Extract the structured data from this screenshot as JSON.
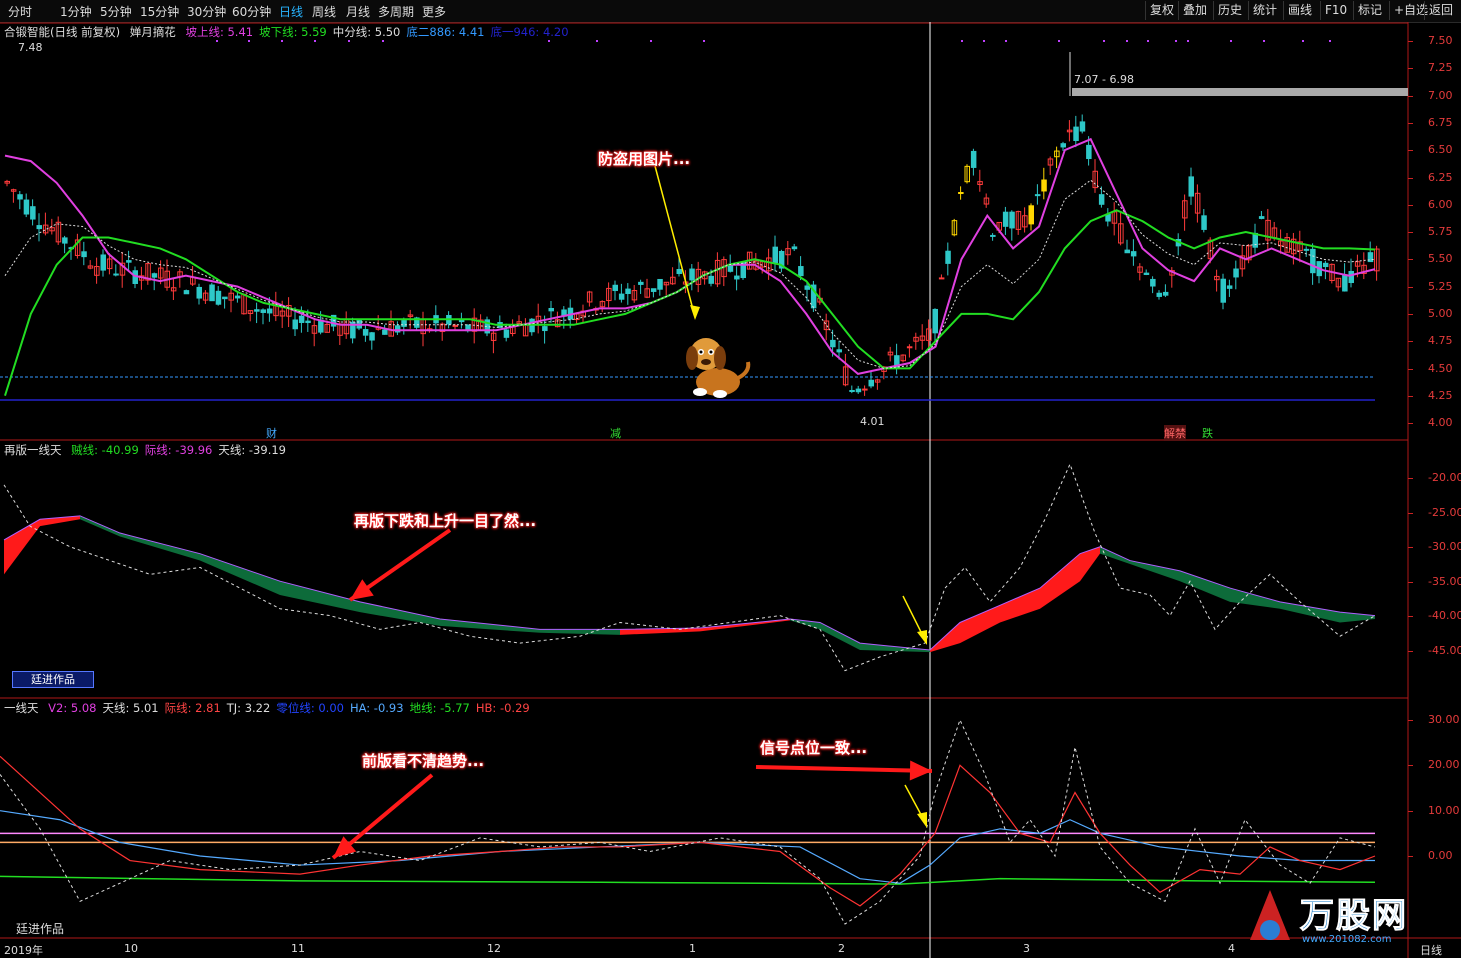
{
  "toolbar": {
    "periods": [
      "分时",
      "1分钟",
      "5分钟",
      "15分钟",
      "30分钟",
      "60分钟",
      "日线",
      "周线",
      "月线",
      "多周期",
      "更多"
    ],
    "active_period": "日线",
    "right_buttons": [
      "复权",
      "叠加",
      "历史",
      "统计",
      "画线",
      "F10",
      "标记",
      "+自选",
      "返回"
    ]
  },
  "panel1": {
    "stock": "合锻智能(日线 前复权)",
    "indicator": "婵月摘花",
    "legend": [
      {
        "label": "坡上线: 5.41",
        "color": "#e040e0"
      },
      {
        "label": "坡下线: 5.59",
        "color": "#22dd22"
      },
      {
        "label": "中分线: 5.50",
        "color": "#dddddd"
      },
      {
        "label": "底二886: 4.41",
        "color": "#3399ff"
      },
      {
        "label": "底一946: 4.20",
        "color": "#2222cc"
      }
    ],
    "axis_ticks": [
      "7.50",
      "7.25",
      "7.00",
      "6.75",
      "6.50",
      "6.25",
      "6.00",
      "5.75",
      "5.50",
      "5.25",
      "5.00",
      "4.75",
      "4.50",
      "4.25",
      "4.00"
    ],
    "high_label": "7.48",
    "low_label": "4.01",
    "range_label": "7.07 - 6.98",
    "markers": [
      {
        "text": "财",
        "color": "#44aaff"
      },
      {
        "text": "减",
        "color": "#33dd33"
      },
      {
        "text": "解禁",
        "color": "#ff6666"
      },
      {
        "text": "跌",
        "color": "#33dd33"
      }
    ]
  },
  "panel2": {
    "title": "再版一线天",
    "legend": [
      {
        "label": "贼线: -40.99",
        "color": "#22dd22"
      },
      {
        "label": "际线: -39.96",
        "color": "#e040e0"
      },
      {
        "label": "天线: -39.19",
        "color": "#dddddd"
      }
    ],
    "axis_ticks": [
      "-20.00",
      "-25.00",
      "-30.00",
      "-35.00",
      "-40.00",
      "-45.00"
    ],
    "author_box": "廷进作品"
  },
  "panel3": {
    "title": "一线天",
    "legend": [
      {
        "label": "V2: 5.08",
        "color": "#e040e0"
      },
      {
        "label": "天线: 5.01",
        "color": "#dddddd"
      },
      {
        "label": "际线: 2.81",
        "color": "#ff4444"
      },
      {
        "label": "TJ: 3.22",
        "color": "#dddddd"
      },
      {
        "label": "零位线: 0.00",
        "color": "#2244ff"
      },
      {
        "label": "HA: -0.93",
        "color": "#55aaff"
      },
      {
        "label": "地线: -5.77",
        "color": "#22dd22"
      },
      {
        "label": "HB: -0.29",
        "color": "#ff4444"
      }
    ],
    "axis_ticks": [
      "30.00",
      "20.00",
      "10.00",
      "0.00"
    ],
    "footer_author": "廷进作品"
  },
  "dates": [
    "2019年",
    "10",
    "11",
    "12",
    "1",
    "2",
    "3",
    "4"
  ],
  "annotations": {
    "a1": "防盗用图片...",
    "a2": "再版下跌和上升一目了然...",
    "a3": "前版看不清趋势...",
    "a4": "信号点位一致..."
  },
  "watermark": {
    "text": "万股网",
    "url": "www.201082.com"
  },
  "footer_tab": "日线",
  "chart_data": {
    "type": "line",
    "title": "婵月摘花",
    "ylim": [
      4.0,
      7.5
    ],
    "series": [
      {
        "name": "坡上线",
        "values": [
          6.45,
          6.4,
          6.2,
          5.9,
          5.55,
          5.35,
          5.3,
          5.35,
          5.3,
          5.25,
          5.15,
          5.05,
          4.95,
          4.9,
          4.9,
          4.85,
          4.85,
          4.85,
          4.85,
          4.85,
          4.9,
          4.95,
          5.0,
          5.05,
          5.05,
          5.1,
          5.2,
          5.35,
          5.45,
          5.45,
          5.3,
          5.0,
          4.65,
          4.45,
          4.5,
          4.55,
          4.7,
          5.5,
          5.9,
          5.6,
          5.8,
          6.5,
          6.6,
          6.1,
          5.6,
          5.4,
          5.3,
          5.6,
          5.5,
          5.6,
          5.5,
          5.4,
          5.35,
          5.41
        ]
      },
      {
        "name": "坡下线",
        "values": [
          4.25,
          5.0,
          5.45,
          5.7,
          5.7,
          5.65,
          5.6,
          5.5,
          5.35,
          5.2,
          5.1,
          5.05,
          5.0,
          4.95,
          4.95,
          4.95,
          4.95,
          4.95,
          4.95,
          4.9,
          4.9,
          4.9,
          4.9,
          4.95,
          5.0,
          5.1,
          5.2,
          5.35,
          5.45,
          5.5,
          5.45,
          5.3,
          5.0,
          4.7,
          4.5,
          4.5,
          4.75,
          5.0,
          5.0,
          4.95,
          5.2,
          5.6,
          5.85,
          5.95,
          5.85,
          5.7,
          5.6,
          5.7,
          5.75,
          5.7,
          5.65,
          5.6,
          5.6,
          5.59
        ]
      }
    ]
  }
}
